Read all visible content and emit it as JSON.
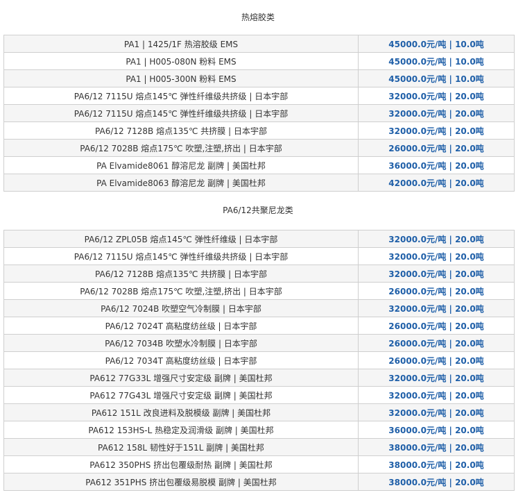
{
  "sections": [
    {
      "title": "热熔胶类",
      "rows": [
        {
          "product": "PA1 | 1425/1F 热溶胶级 EMS",
          "price": "45000.0元/吨 | 10.0吨"
        },
        {
          "product": "PA1 | H005-080N 粉料 EMS",
          "price": "45000.0元/吨 | 10.0吨"
        },
        {
          "product": "PA1 | H005-300N 粉料 EMS",
          "price": "45000.0元/吨 | 10.0吨"
        },
        {
          "product": "PA6/12 7115U 熔点145℃ 弹性纤维级共挤级 | 日本宇部",
          "price": "32000.0元/吨 | 20.0吨"
        },
        {
          "product": "PA6/12 7115U 熔点145℃ 弹性纤维级共挤级 | 日本宇部",
          "price": "32000.0元/吨 | 20.0吨"
        },
        {
          "product": "PA6/12 7128B 熔点135℃ 共挤膜 | 日本宇部",
          "price": "32000.0元/吨 | 20.0吨"
        },
        {
          "product": "PA6/12 7028B 熔点175℃ 吹塑,注塑,挤出 | 日本宇部",
          "price": "26000.0元/吨 | 20.0吨"
        },
        {
          "product": "PA Elvamide8061 醇溶尼龙 副牌 | 美国杜邦",
          "price": "36000.0元/吨 | 20.0吨"
        },
        {
          "product": "PA Elvamide8063 醇溶尼龙 副牌 | 美国杜邦",
          "price": "42000.0元/吨 | 20.0吨"
        }
      ]
    },
    {
      "title": "PA6/12共聚尼龙类",
      "rows": [
        {
          "product": "PA6/12 ZPL05B 熔点145℃ 弹性纤维级 | 日本宇部",
          "price": "32000.0元/吨 | 20.0吨"
        },
        {
          "product": "PA6/12 7115U 熔点145℃ 弹性纤维级共挤级 | 日本宇部",
          "price": "32000.0元/吨 | 20.0吨"
        },
        {
          "product": "PA6/12 7128B 熔点135℃ 共挤膜 | 日本宇部",
          "price": "32000.0元/吨 | 20.0吨"
        },
        {
          "product": "PA6/12 7028B 熔点175℃ 吹塑,注塑,挤出 | 日本宇部",
          "price": "26000.0元/吨 | 20.0吨"
        },
        {
          "product": "PA6/12 7024B 吹塑空气冷制膜 | 日本宇部",
          "price": "32000.0元/吨 | 20.0吨"
        },
        {
          "product": "PA6/12 7024T 高粘度纺丝级 | 日本宇部",
          "price": "26000.0元/吨 | 20.0吨"
        },
        {
          "product": "PA6/12 7034B 吹塑水冷制膜 | 日本宇部",
          "price": "26000.0元/吨 | 20.0吨"
        },
        {
          "product": "PA6/12 7034T 高粘度纺丝级 | 日本宇部",
          "price": "26000.0元/吨 | 20.0吨"
        },
        {
          "product": "PA612 77G33L 增强尺寸安定级 副牌 | 美国杜邦",
          "price": "32000.0元/吨 | 20.0吨"
        },
        {
          "product": "PA612 77G43L 增强尺寸安定级 副牌 | 美国杜邦",
          "price": "32000.0元/吨 | 20.0吨"
        },
        {
          "product": "PA612 151L 改良进料及脱模级 副牌 | 美国杜邦",
          "price": "32000.0元/吨 | 20.0吨"
        },
        {
          "product": "PA612 153HS-L 热稳定及润滑级 副牌 | 美国杜邦",
          "price": "36000.0元/吨 | 20.0吨"
        },
        {
          "product": "PA612 158L 韧性好于151L 副牌 | 美国杜邦",
          "price": "38000.0元/吨 | 20.0吨"
        },
        {
          "product": "PA612 350PHS 挤出包覆级耐热 副牌 | 美国杜邦",
          "price": "38000.0元/吨 | 20.0吨"
        },
        {
          "product": "PA612 351PHS 挤出包覆级易脱模 副牌 | 美国杜邦",
          "price": "38000.0元/吨 | 20.0吨"
        }
      ]
    }
  ]
}
